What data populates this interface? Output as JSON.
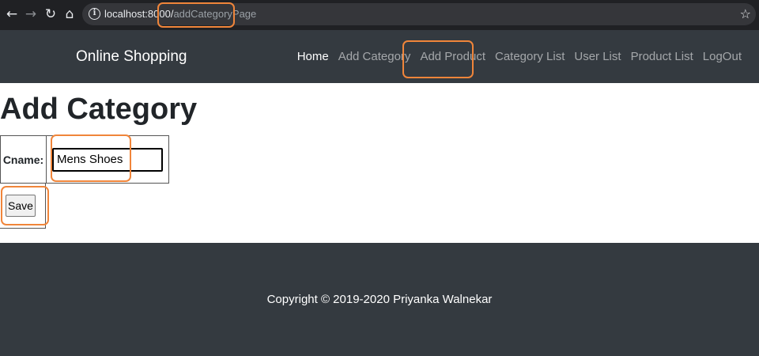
{
  "browser": {
    "url_host": "localhost:8000/",
    "url_path": "addCategoryPage"
  },
  "navbar": {
    "brand": "Online Shopping",
    "links": [
      "Home",
      "Add Category",
      "Add Product",
      "Category List",
      "User List",
      "Product List",
      "LogOut"
    ]
  },
  "page": {
    "title": "Add Category",
    "form": {
      "cname_label": "Cname:",
      "cname_value": "Mens Shoes",
      "save_label": "Save"
    }
  },
  "footer": {
    "copyright": "Copyright © 2019-2020 Priyanka Walnekar"
  },
  "colors": {
    "navbar_bg": "#343a40",
    "browser_bg": "#202124",
    "annotation": "#f0853a"
  }
}
